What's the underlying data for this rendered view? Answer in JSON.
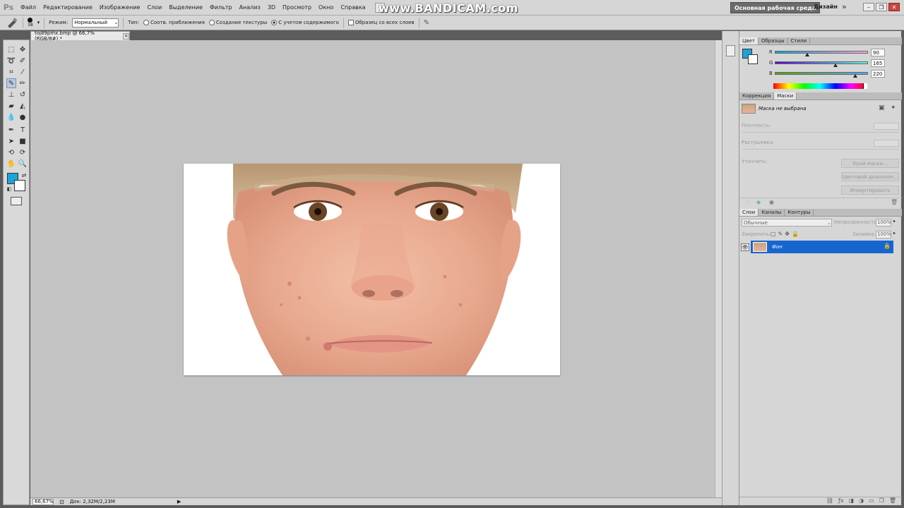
{
  "app": {
    "logo": "Ps",
    "watermark": "www.BANDICAM.com"
  },
  "menu": {
    "items": [
      "Файл",
      "Редактирование",
      "Изображение",
      "Слои",
      "Выделение",
      "Фильтр",
      "Анализ",
      "3D",
      "Просмотр",
      "Окно",
      "Справка"
    ],
    "workspace_button": "Основная рабочая среда",
    "design_label": "Дизайн",
    "more": "»"
  },
  "options": {
    "brush_size": "38",
    "mode_label": "Режим:",
    "mode_value": "Нормальный",
    "type_label": "Тип:",
    "radio_proximity": "Соотв. приближения",
    "radio_texture": "Создание текстуры",
    "radio_content": "С учетом содержимого",
    "sample_all": "Образец со всех слоев"
  },
  "document": {
    "tab_title": "toj89pmx.bmp @ 66,7% (RGB/8#) *",
    "tab_close": "×",
    "zoom": "66,67%",
    "doc_info": "Док: 2,32M/2,23M"
  },
  "colors": {
    "foreground": "#1aa4dc",
    "background": "#ffffff",
    "selection": "#1666d0"
  },
  "color_panel": {
    "tabs": [
      "Цвет",
      "Образцы",
      "Стили"
    ],
    "r_label": "R",
    "g_label": "G",
    "b_label": "B",
    "r": "90",
    "g": "165",
    "b": "220",
    "r_fraction": 0.35,
    "g_fraction": 0.65,
    "b_fraction": 0.86
  },
  "masks_panel": {
    "tabs": [
      "Коррекция",
      "Маски"
    ],
    "no_mask": "Маска не выбрана",
    "density": "Плотность:",
    "feather": "Растушевка:",
    "refine": "Уточнить:",
    "mask_edge": "Край маски...",
    "color_range": "Цветовой диапазон...",
    "invert": "Инвертировать"
  },
  "layers_panel": {
    "tabs": [
      "Слои",
      "Каналы",
      "Контуры"
    ],
    "blend_mode": "Обычные",
    "opacity_label": "Непрозрачность:",
    "opacity": "100%",
    "lock_label": "Закрепить:",
    "fill_label": "Заливка:",
    "fill": "100%",
    "layer_name": "Фон"
  }
}
